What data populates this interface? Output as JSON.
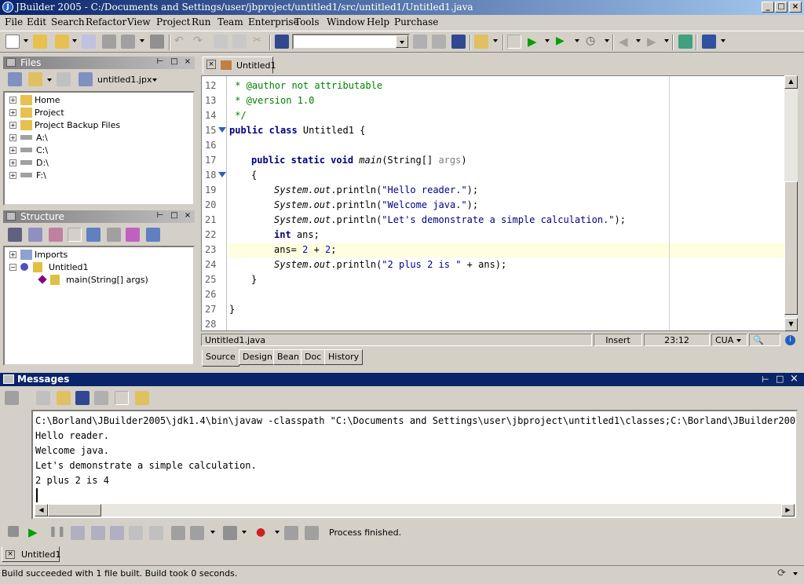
{
  "window": {
    "title": "JBuilder 2005 - C:/Documents and Settings/user/jbproject/untitled1/src/untitled1/Untitled1.java",
    "app_icon": "J"
  },
  "menu": [
    "File",
    "Edit",
    "Search",
    "Refactor",
    "View",
    "Project",
    "Run",
    "Team",
    "Enterprise",
    "Tools",
    "Window",
    "Help",
    "Purchase"
  ],
  "files_panel": {
    "title": "Files",
    "project_combo": "untitled1.jpx",
    "items": [
      "Home",
      "Project",
      "Project Backup Files",
      "A:\\",
      "C:\\",
      "D:\\",
      "F:\\"
    ]
  },
  "structure_panel": {
    "title": "Structure",
    "items": [
      "Imports",
      "Untitled1",
      "main(String[] args)"
    ]
  },
  "editor": {
    "tab": "Untitled1",
    "line_numbers": [
      "12",
      "13",
      "14",
      "15",
      "16",
      "17",
      "18",
      "19",
      "20",
      "21",
      "22",
      "23",
      "24",
      "25",
      "26",
      "27",
      "28"
    ],
    "code": {
      "l12": " * @author not attributable",
      "l13": " * @version 1.0",
      "l14": " */",
      "l15_kw": "public class",
      "l15_rest": " Untitled1 {",
      "l17_kw": "public static void",
      "l17_name": "main",
      "l17_rest": "(String[] ",
      "l17_args": "args",
      "l17_close": ")",
      "l18": "{",
      "sys": "System.",
      "out": "out",
      "println": ".println(",
      "l19_str": "\"Hello reader.\"",
      "l20_str": "\"Welcome java.\"",
      "l21_str": "\"Let's demonstrate a simple calculation.\"",
      "end": ");",
      "l22_kw": "int",
      "l22_rest": " ans;",
      "l23_a": "ans= ",
      "l23_n1": "2",
      "l23_op": " + ",
      "l23_n2": "2",
      "l23_end": ";",
      "l24_str": "\"2 plus 2 is \"",
      "l24_rest": " + ans);",
      "l25": "}",
      "l27": "}"
    },
    "status": {
      "file": "Untitled1.java",
      "mode": "Insert",
      "position": "23:12",
      "keymap": "CUA"
    },
    "bottom_tabs": [
      "Source",
      "Design",
      "Bean",
      "Doc",
      "History"
    ]
  },
  "messages": {
    "title": "Messages",
    "output": [
      "C:\\Borland\\JBuilder2005\\jdk1.4\\bin\\javaw -classpath \"C:\\Documents and Settings\\user\\jbproject\\untitled1\\classes;C:\\Borland\\JBuilder2005\\jdk",
      "Hello reader.",
      "Welcome java.",
      "Let's demonstrate a simple calculation.",
      "2 plus 2 is 4"
    ],
    "process_status": "Process finished.",
    "run_tab": "Untitled1"
  },
  "statusbar": {
    "text": "Build succeeded with 1 file built.  Build took 0 seconds."
  },
  "colors": {
    "title_active": "#0a246a",
    "panel_inactive": "#808080",
    "keyword": "#000080",
    "comment": "#008000",
    "number": "#0000ff",
    "highlight_line": "#ffffe0"
  }
}
